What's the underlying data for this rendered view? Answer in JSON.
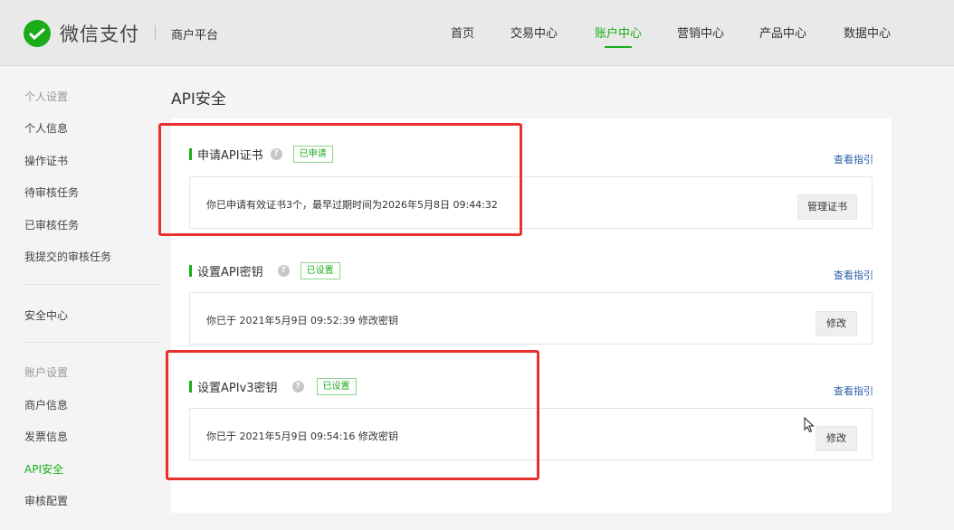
{
  "header": {
    "brand": "微信支付",
    "platform": "商户平台",
    "nav": [
      {
        "label": "首页"
      },
      {
        "label": "交易中心"
      },
      {
        "label": "账户中心",
        "active": true
      },
      {
        "label": "营销中心"
      },
      {
        "label": "产品中心"
      },
      {
        "label": "数据中心"
      }
    ]
  },
  "sidebar": {
    "groups": [
      {
        "title": "个人设置",
        "items": [
          "个人信息",
          "操作证书",
          "待审核任务",
          "已审核任务",
          "我提交的审核任务"
        ]
      },
      {
        "title": "",
        "items": [
          "安全中心"
        ]
      },
      {
        "title": "账户设置",
        "items": [
          "商户信息",
          "发票信息",
          "API安全",
          "审核配置"
        ]
      }
    ],
    "active_item": "API安全"
  },
  "main": {
    "title": "API安全",
    "sections": [
      {
        "title": "申请API证书",
        "badge": "已申请",
        "guide": "查看指引",
        "info": "你已申请有效证书3个，最早过期时间为2026年5月8日 09:44:32",
        "button": "管理证书"
      },
      {
        "title": "设置API密钥",
        "badge": "已设置",
        "guide": "查看指引",
        "info": "你已于 2021年5月9日 09:52:39 修改密钥",
        "button": "修改"
      },
      {
        "title": "设置APIv3密钥",
        "badge": "已设置",
        "guide": "查看指引",
        "info": "你已于 2021年5月9日 09:54:16 修改密钥",
        "button": "修改"
      }
    ]
  },
  "icons": {
    "brand": "wechat-pay-logo-icon",
    "help": "question-icon",
    "cursor": "mouse-pointer-icon"
  },
  "colors": {
    "accent": "#1aad19",
    "highlight": "#e8312f",
    "link": "#2a5da8"
  }
}
